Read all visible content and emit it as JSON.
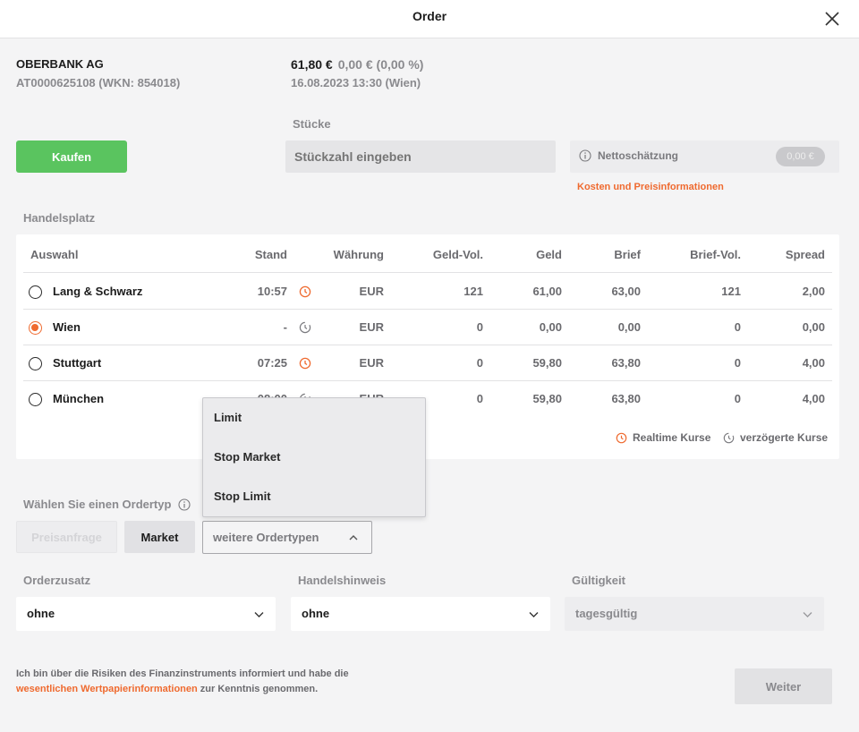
{
  "header": {
    "title": "Order"
  },
  "instrument": {
    "name": "OBERBANK AG",
    "identifier": "AT0000625108 (WKN: 854018)",
    "price": "61,80 €",
    "change": "0,00 € (0,00 %)",
    "date": "16.08.2023 13:30 (Wien)"
  },
  "order": {
    "kaufen_label": "Kaufen",
    "stuecke_label": "Stücke",
    "qty_placeholder": "Stückzahl eingeben",
    "netto_label": "Nettoschätzung",
    "netto_value": "0,00 €",
    "kosten_link": "Kosten und Preisinformationen"
  },
  "handelsplatz": {
    "label": "Handelsplatz",
    "columns": [
      "Auswahl",
      "Stand",
      "Währung",
      "Geld-Vol.",
      "Geld",
      "Brief",
      "Brief-Vol.",
      "Spread"
    ],
    "rows": [
      {
        "name": "Lang & Schwarz",
        "stand": "10:57",
        "realtime": true,
        "waehrung": "EUR",
        "geld_vol": "121",
        "geld": "61,00",
        "brief": "63,00",
        "brief_vol": "121",
        "spread": "2,00",
        "selected": false
      },
      {
        "name": "Wien",
        "stand": "-",
        "realtime": false,
        "waehrung": "EUR",
        "geld_vol": "0",
        "geld": "0,00",
        "brief": "0,00",
        "brief_vol": "0",
        "spread": "0,00",
        "selected": true
      },
      {
        "name": "Stuttgart",
        "stand": "07:25",
        "realtime": true,
        "waehrung": "EUR",
        "geld_vol": "0",
        "geld": "59,80",
        "brief": "63,80",
        "brief_vol": "0",
        "spread": "4,00",
        "selected": false
      },
      {
        "name": "München",
        "stand": "08:00",
        "realtime": false,
        "waehrung": "EUR",
        "geld_vol": "0",
        "geld": "59,80",
        "brief": "63,80",
        "brief_vol": "0",
        "spread": "4,00",
        "selected": false
      }
    ],
    "legend_realtime": "Realtime Kurse",
    "legend_delayed": "verzögerte Kurse"
  },
  "ordertyp": {
    "label": "Wählen Sie einen Ordertyp",
    "preisanfrage": "Preisanfrage",
    "market": "Market",
    "weitere": "weitere Ordertypen",
    "dropdown_options": [
      "Limit",
      "Stop Market",
      "Stop Limit"
    ]
  },
  "zusatz": {
    "orderzusatz_label": "Orderzusatz",
    "orderzusatz_value": "ohne",
    "handelshinweis_label": "Handelshinweis",
    "handelshinweis_value": "ohne",
    "gueltigkeit_label": "Gültigkeit",
    "gueltigkeit_value": "tagesgültig"
  },
  "footer": {
    "risk_text_1": "Ich bin über die Risiken des Finanzinstruments informiert und habe die",
    "risk_link": "wesentlichen Wertpapierinformationen",
    "risk_text_2": " zur Kenntnis genommen.",
    "weiter": "Weiter"
  },
  "colors": {
    "accent": "#ef6a2f",
    "buy": "#5ac45f",
    "background": "#f4f4f5"
  }
}
